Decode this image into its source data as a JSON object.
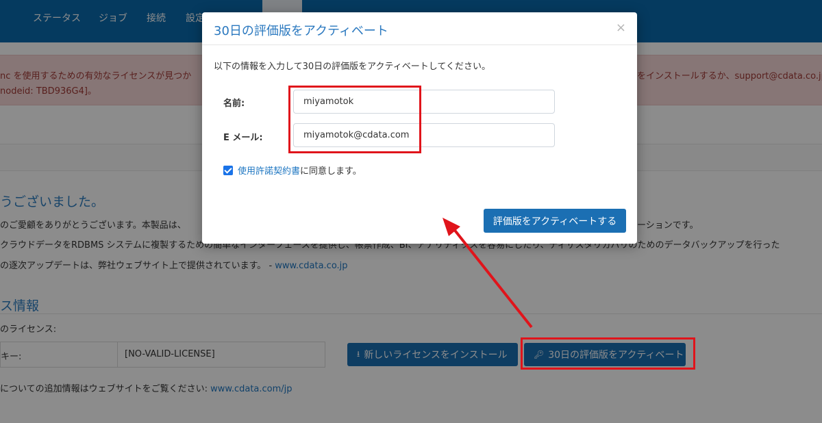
{
  "topnav": {
    "items": [
      "ステータス",
      "ジョブ",
      "接続",
      "設定"
    ]
  },
  "alert": {
    "line1_left": "nc を使用するための有効なライセンスが見つか",
    "line1_right": "をインストールするか、support@cdata.co.jp",
    "line2": "nodeid: TBD936G4]。"
  },
  "welcome": {
    "heading": "うございました。",
    "line1_left": "のご愛顧をありがとうございます。本製品は、",
    "line1_right": "ーションです。",
    "line2": "クラウドデータをRDBMS システムに複製するための簡単なインターフェースを提供し、帳票作成、BI、アナリティクスを容易にしたり、ディザスタリカバリのためのデータバックアップを行った",
    "line3_text": "の逐次アップデートは、弊社ウェブサイト上で提供されています。 - ",
    "line3_link": "www.cdata.co.jp"
  },
  "license": {
    "heading": "ス情報",
    "current_label": "のライセンス:",
    "key_label": "キー:",
    "key_value": "[NO-VALID-LICENSE]",
    "install_button": "新しいライセンスをインストール",
    "trial_button": "30日の評価版をアクティベート",
    "more_info_text": "についての追加情報はウェブサイトをご覧ください: ",
    "more_info_link": "www.cdata.com/jp"
  },
  "modal": {
    "title": "30日の評価版をアクティベート",
    "close": "×",
    "intro": "以下の情報を入力して30日の評価版をアクティベートしてください。",
    "name_label": "名前:",
    "name_value": "miyamotok",
    "email_label": "E メール:",
    "email_value": "miyamotok@cdata.com",
    "agree_link": "使用許諾契約書",
    "agree_text": "に同意します。",
    "submit": "評価版をアクティベートする"
  },
  "colors": {
    "brand": "#0a6aae",
    "button": "#1b6fb3",
    "annotation": "#e0141b"
  }
}
